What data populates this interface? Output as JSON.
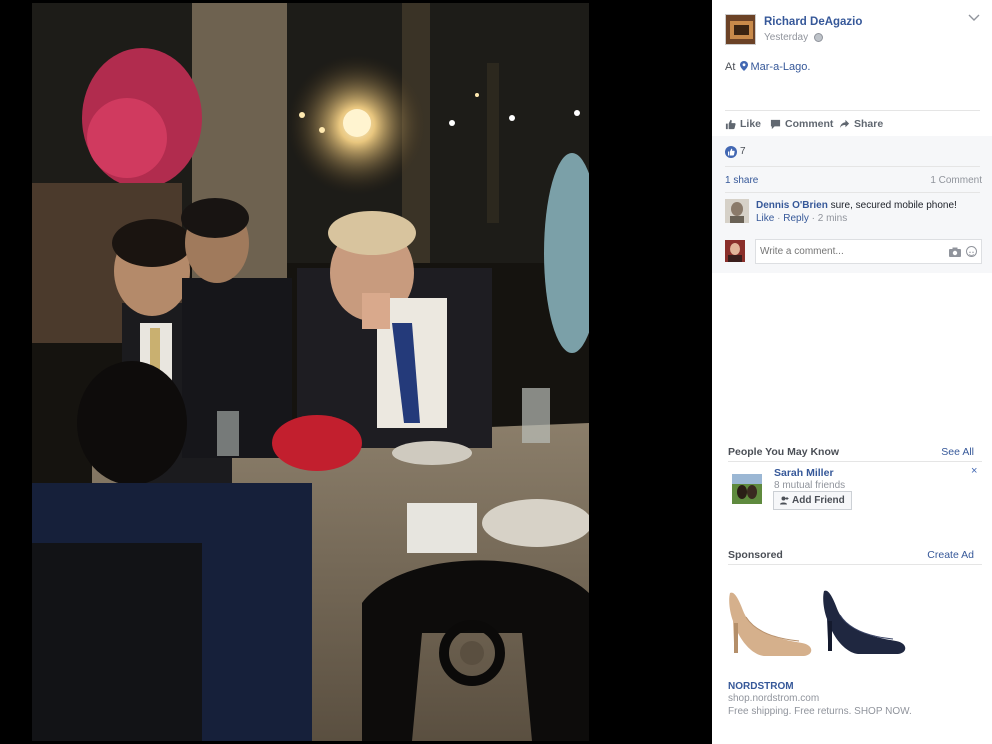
{
  "post": {
    "author": "Richard DeAgazio",
    "time": "Yesterday",
    "location_prefix": "At",
    "location": "Mar-a-Lago."
  },
  "actions": {
    "like": "Like",
    "comment": "Comment",
    "share": "Share"
  },
  "stats": {
    "likes": "7",
    "shares": "1 share",
    "comments": "1 Comment"
  },
  "comment": {
    "author": "Dennis O'Brien",
    "text": "sure, secured mobile phone!",
    "like": "Like",
    "sep": "·",
    "reply": "Reply",
    "time": "2 mins",
    "input_placeholder": "Write a comment..."
  },
  "pymk": {
    "title": "People You May Know",
    "see_all": "See All",
    "name": "Sarah Miller",
    "mutual": "8 mutual friends",
    "add_friend": "Add Friend",
    "close": "×"
  },
  "sponsored": {
    "title": "Sponsored",
    "create_ad": "Create Ad",
    "brand": "NORDSTROM",
    "domain": "shop.nordstrom.com",
    "tagline": "Free shipping. Free returns. SHOP NOW."
  },
  "colors": {
    "facebook_blue": "#4267b2",
    "link_blue": "#365899",
    "panel_bg": "#ffffff",
    "muted_gray": "#90949c"
  }
}
